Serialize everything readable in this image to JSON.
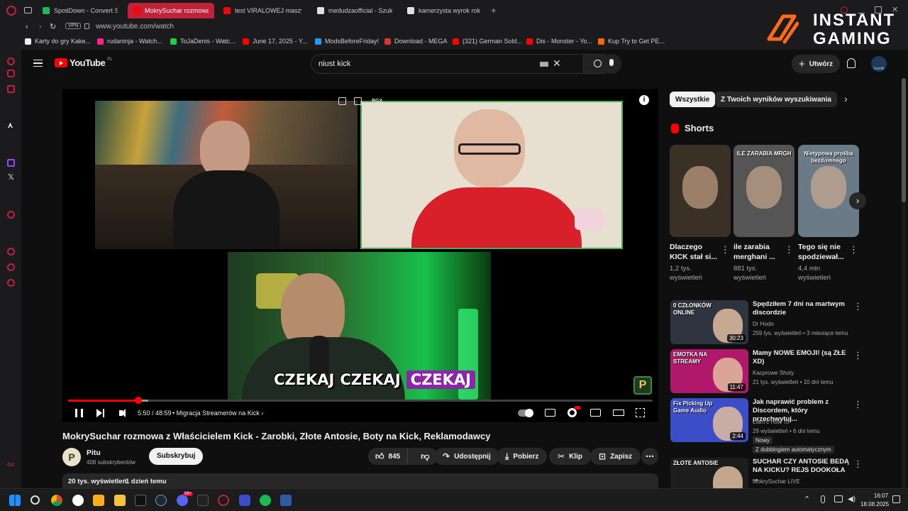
{
  "browser": {
    "tabs": [
      {
        "title": "SpotiDown - Convert Spo",
        "active": false,
        "color": "#1db954"
      },
      {
        "title": "MokrySuchar rozmowa",
        "active": true,
        "color": "#ff0000"
      },
      {
        "title": "test VIRALOWEJ maszyny",
        "active": false,
        "color": "#ff0000"
      },
      {
        "title": "medudzaofficial - Szukaj",
        "active": false,
        "color": "#e0e0e0"
      },
      {
        "title": "kamerzysta wyrok rok - S",
        "active": false,
        "color": "#e0e0e0"
      }
    ],
    "new_tab": "+",
    "vpn": "VPN",
    "url": "www.youtube.com/watch",
    "bookmarks": [
      "Karty do gry Kake...",
      "rudaninja - Watch...",
      "ToJaDenis - Watc...",
      "June 17, 2025 - Y...",
      "ModsBeforeFriday!",
      "Download - MEGA",
      "(321) German Sold...",
      "Dis - Monster - Yo...",
      "Kup Try to Get PE..."
    ],
    "sidebar_gx": "GX"
  },
  "ad_overlay": {
    "line1": "INSTANT",
    "line2": "GAMING"
  },
  "youtube": {
    "logo_text": "YouTube",
    "logo_region": "PL",
    "search_value": "niust kick",
    "create_label": "Utwórz",
    "avatar_label": "Sumfik"
  },
  "player": {
    "caption_words": [
      "CZEKAJ",
      "CZEKAJ",
      "CZEKAJ"
    ],
    "time": "5:50 / 48:59",
    "chapter": "Migracja Streamerów na Kick",
    "progress_fraction": 0.12,
    "overlay_tag": "RGX",
    "watermark": "P"
  },
  "video": {
    "title": "MokrySuchar rozmowa z Właścicielem Kick - Zarobki, Złote Antosie, Boty na Kick, Reklamodawcy",
    "channel": "Pitu",
    "channel_initial": "P",
    "subscribers": "408 subskrybentów",
    "subscribe_label": "Subskrybuj",
    "likes": "845",
    "share_label": "Udostępnij",
    "download_label": "Pobierz",
    "clip_label": "Klip",
    "save_label": "Zapisz",
    "views": "20 tys. wyświetleń",
    "date": "1 dzień temu"
  },
  "right": {
    "chips": [
      "Wszystkie",
      "Z Twoich wyników wyszukiwania"
    ],
    "shorts_header": "Shorts",
    "shorts": [
      {
        "title_line1": "Dlaczego",
        "title_line2": "KICK stał si...",
        "views_line1": "1,2 tys.",
        "views_line2": "wyświetleń",
        "thumb_text": "",
        "thumb_color": "#3a3025"
      },
      {
        "title_line1": "ile zarabia",
        "title_line2": "merghani ...",
        "views_line1": "881 tys.",
        "views_line2": "wyświetleń",
        "thumb_text": "ILE ZARABIA MRGH",
        "thumb_color": "#555"
      },
      {
        "title_line1": "Tego się nie",
        "title_line2": "spodziewał...",
        "views_line1": "4,4 mln",
        "views_line2": "wyświetleń",
        "thumb_text": "Nietypowa prośba bezdomnego",
        "thumb_color": "#6a7a86"
      }
    ],
    "videos": [
      {
        "title": "Spędziłem 7 dni na martwym discordzie",
        "channel": "Dr Hodo",
        "meta": "259 tys. wyświetleń • 3 miesiące temu",
        "duration": "30:23",
        "thumb_text": "0 CZŁONKÓW ONLINE",
        "thumb_color": "#2e3440",
        "badge": "",
        "badge2": ""
      },
      {
        "title": "Mamy NOWE EMOJI! (są ZŁE XD)",
        "channel": "Kacprowe Shoty",
        "meta": "21 tys. wyświetleń • 10 dni temu",
        "duration": "11:47",
        "thumb_text": "EMOTKA NA STREAMY",
        "thumb_color": "#b0186c",
        "badge": "",
        "badge2": ""
      },
      {
        "title": "Jak naprawić problem z Discordem, który przechwytuj...",
        "channel": "Liam's How To",
        "meta": "29 wyświetleń • 6 dni temu",
        "duration": "2:44",
        "thumb_text": "Fix Picking Up Game Audio",
        "thumb_color": "#3b4ec8",
        "badge": "Nowy",
        "badge2": "Z dubbingiem automatycznym"
      },
      {
        "title": "SUCHAR CZY ANTOSIE BEDĄ NA KICKU? REJS DOOKOŁA ...",
        "channel": "MokrySuchar LIVE",
        "meta": "",
        "duration": "",
        "thumb_text": "ZŁOTE ANTOSIE",
        "thumb_color": "#1d1d1d",
        "badge": "",
        "badge2": ""
      }
    ]
  },
  "taskbar": {
    "time": "16:07",
    "date": "18.08.2025",
    "badge": "99+"
  }
}
